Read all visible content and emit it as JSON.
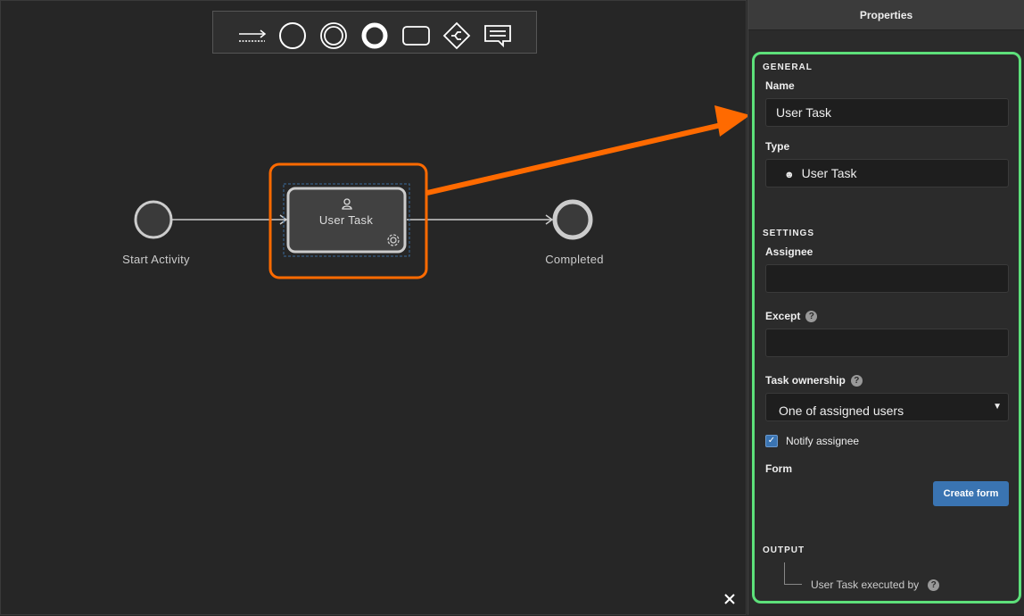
{
  "toolbar": {
    "tools": [
      "sequence-flow-icon",
      "start-event-icon",
      "intermediate-event-icon",
      "end-event-icon",
      "task-icon",
      "gateway-icon",
      "annotation-icon"
    ]
  },
  "diagram": {
    "start_label": "Start Activity",
    "task_label": "User Task",
    "end_label": "Completed"
  },
  "panel": {
    "title": "Properties",
    "general": "GENERAL",
    "name_label": "Name",
    "name_value": "User Task",
    "type_label": "Type",
    "type_value": "User Task",
    "settings": "SETTINGS",
    "assignee_label": "Assignee",
    "assignee_value": "",
    "except_label": "Except",
    "except_value": "",
    "ownership_label": "Task ownership",
    "ownership_value": "One of assigned users",
    "notify_label": "Notify assignee",
    "notify_checked": true,
    "form_label": "Form",
    "create_form": "Create form",
    "output": "OUTPUT",
    "output_item": "User Task executed by",
    "help": "?"
  },
  "colors": {
    "highlight": "#ff6a00",
    "frame": "#5de07a",
    "button": "#3a74b2"
  }
}
